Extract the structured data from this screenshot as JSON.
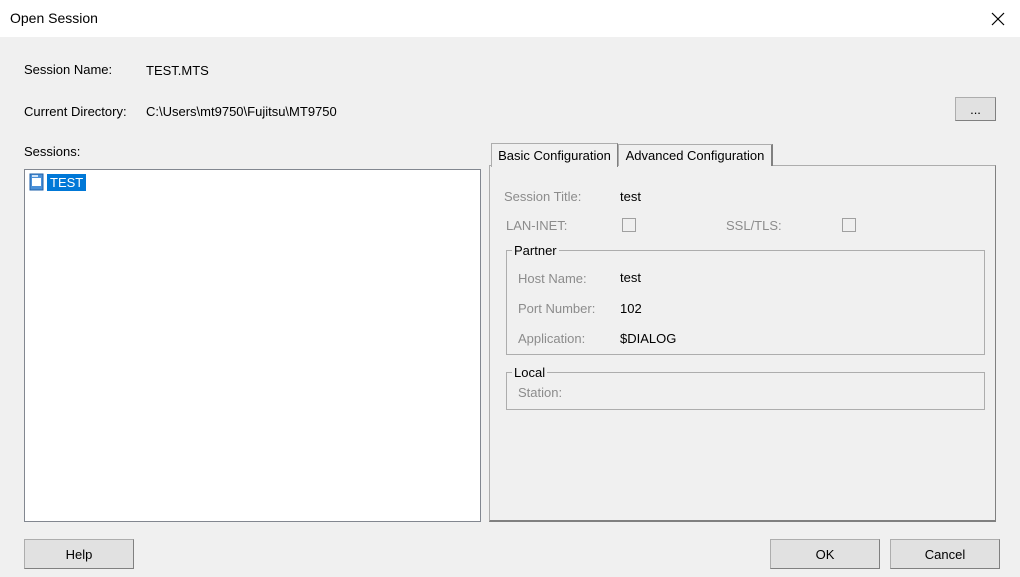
{
  "window": {
    "title": "Open Session",
    "close_glyph": "✕"
  },
  "header": {
    "session_name_label": "Session Name:",
    "session_name_value": "TEST.MTS",
    "current_directory_label": "Current Directory:",
    "current_directory_value": "C:\\Users\\mt9750\\Fujitsu\\MT9750",
    "browse_label": "..."
  },
  "sessions": {
    "label": "Sessions:",
    "items": [
      {
        "label": "TEST",
        "icon": "document-icon",
        "selected": true
      }
    ]
  },
  "tabs": [
    {
      "label": "Basic Configuration",
      "active": true
    },
    {
      "label": "Advanced Configuration",
      "active": false
    }
  ],
  "basic": {
    "session_title_label": "Session Title:",
    "session_title_value": "test",
    "lan_inet_label": "LAN-INET:",
    "lan_inet_checked": false,
    "ssl_tls_label": "SSL/TLS:",
    "ssl_tls_checked": false,
    "partner": {
      "legend": "Partner",
      "host_name_label": "Host Name:",
      "host_name_value": "test",
      "port_number_label": "Port Number:",
      "port_number_value": "102",
      "application_label": "Application:",
      "application_value": "$DIALOG"
    },
    "local": {
      "legend": "Local",
      "station_label": "Station:",
      "station_value": ""
    }
  },
  "footer": {
    "help_label": "Help",
    "ok_label": "OK",
    "cancel_label": "Cancel"
  }
}
